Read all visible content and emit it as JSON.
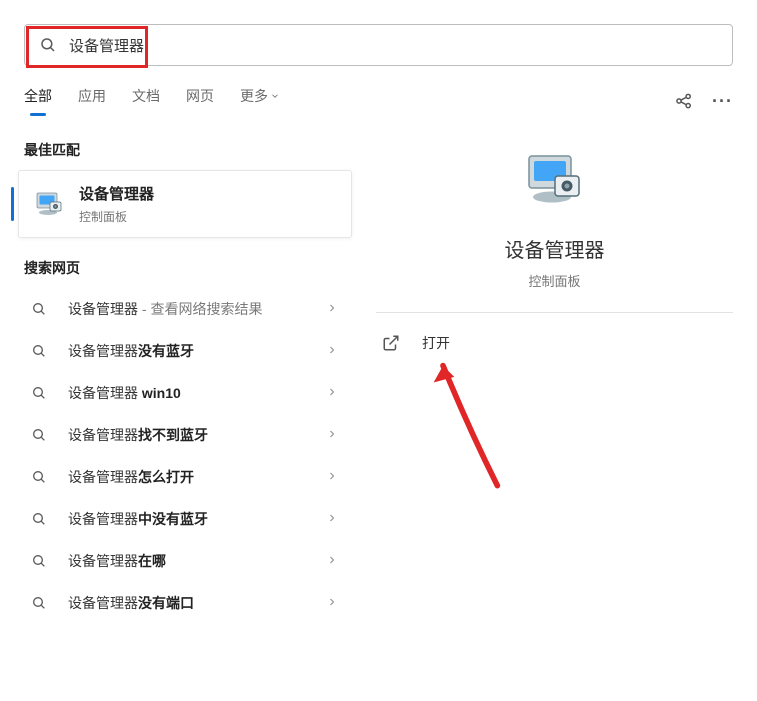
{
  "search": {
    "query": "设备管理器"
  },
  "tabs": [
    {
      "key": "all",
      "label": "全部",
      "active": true
    },
    {
      "key": "apps",
      "label": "应用",
      "active": false
    },
    {
      "key": "docs",
      "label": "文档",
      "active": false
    },
    {
      "key": "web",
      "label": "网页",
      "active": false
    },
    {
      "key": "more",
      "label": "更多",
      "active": false,
      "dropdown": true
    }
  ],
  "sections": {
    "best_match_header": "最佳匹配",
    "web_header": "搜索网页"
  },
  "best_match": {
    "title": "设备管理器",
    "subtitle": "控制面板"
  },
  "web_results": [
    {
      "prefix": "设备管理器",
      "bold": "",
      "suffix": " - 查看网络搜索结果"
    },
    {
      "prefix": "设备管理器",
      "bold": "没有蓝牙",
      "suffix": ""
    },
    {
      "prefix": "设备管理器 ",
      "bold": "win10",
      "suffix": ""
    },
    {
      "prefix": "设备管理器",
      "bold": "找不到蓝牙",
      "suffix": ""
    },
    {
      "prefix": "设备管理器",
      "bold": "怎么打开",
      "suffix": ""
    },
    {
      "prefix": "设备管理器",
      "bold": "中没有蓝牙",
      "suffix": ""
    },
    {
      "prefix": "设备管理器",
      "bold": "在哪",
      "suffix": ""
    },
    {
      "prefix": "设备管理器",
      "bold": "没有端口",
      "suffix": ""
    }
  ],
  "detail": {
    "title": "设备管理器",
    "subtitle": "控制面板",
    "actions": {
      "open": "打开"
    }
  }
}
